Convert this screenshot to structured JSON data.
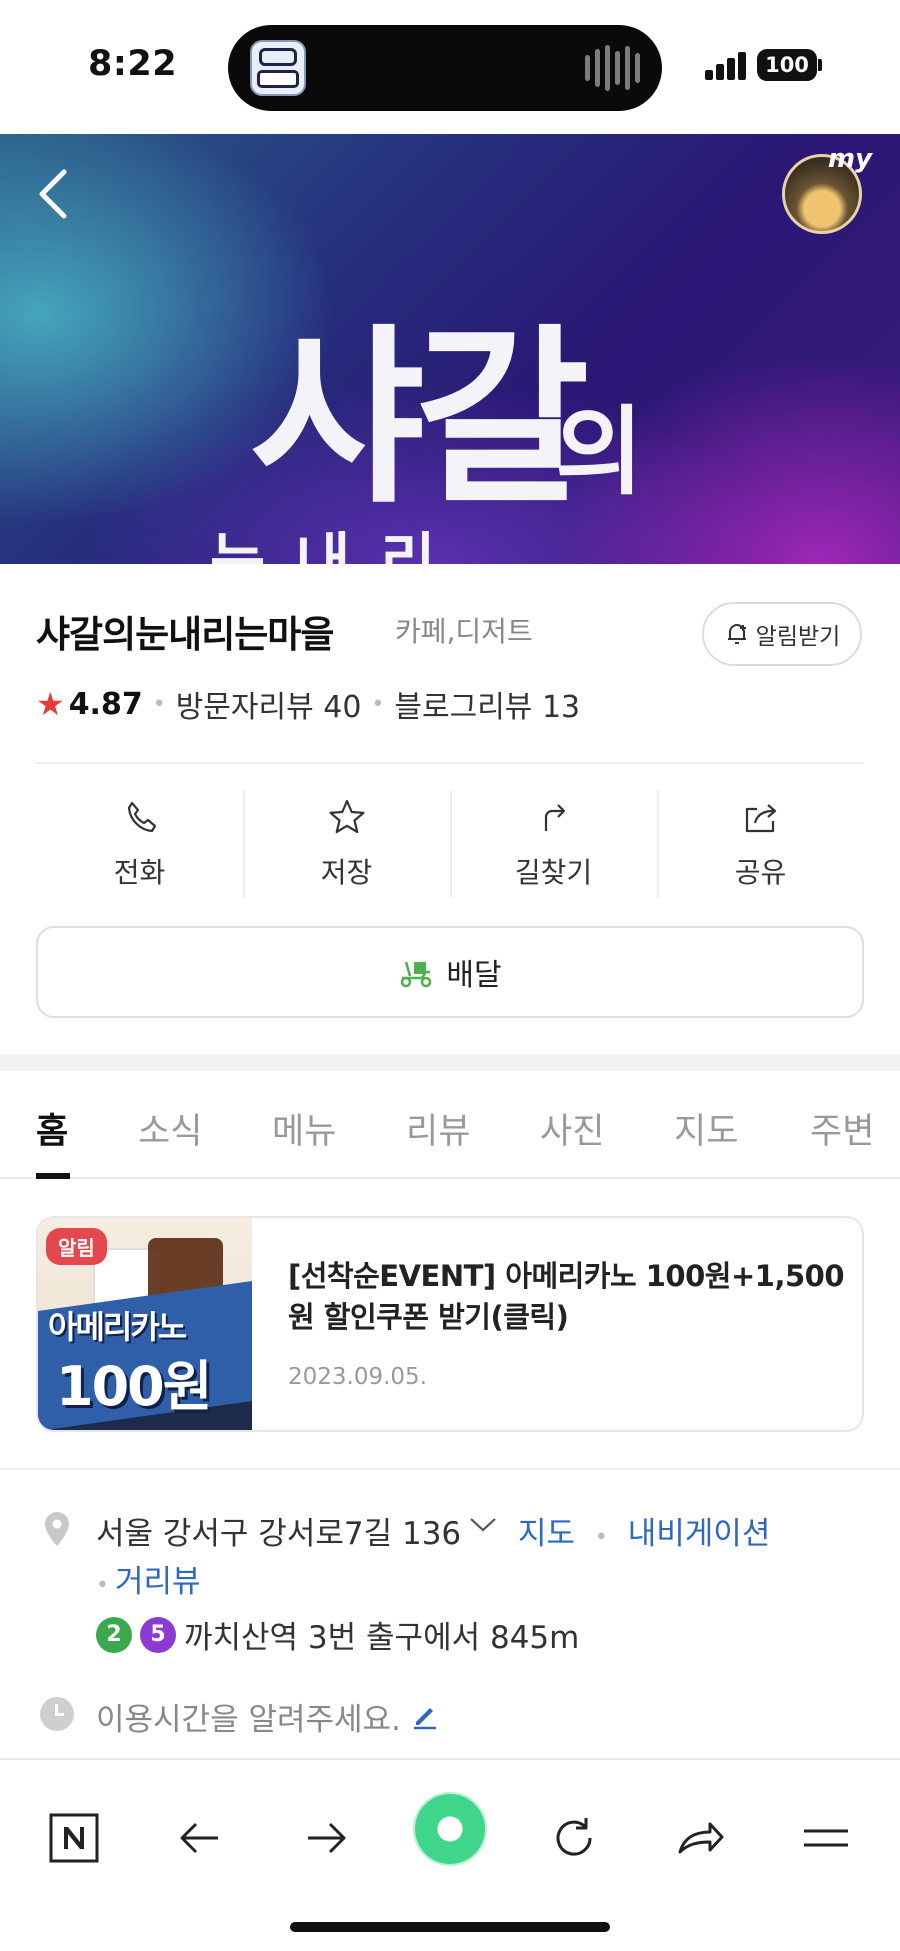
{
  "status_bar": {
    "time": "8:22",
    "battery": "100",
    "island_app_icon": "app-icon"
  },
  "hero": {
    "title": "샤갈",
    "title_suffix": "의",
    "title_bottom": "눈내리",
    "back_icon": "back-chevron-icon",
    "avatar_label": "my"
  },
  "place": {
    "name": "샤갈의눈내리는마을",
    "category": "카페,디저트",
    "alarm_label": "알림받기",
    "rating": "4.87",
    "visitor_reviews": "방문자리뷰 40",
    "blog_reviews": "블로그리뷰 13"
  },
  "actions": [
    {
      "label": "전화",
      "icon": "phone-icon"
    },
    {
      "label": "저장",
      "icon": "star-outline-icon"
    },
    {
      "label": "길찾기",
      "icon": "directions-icon"
    },
    {
      "label": "공유",
      "icon": "share-icon"
    }
  ],
  "delivery": {
    "label": "배달",
    "icon": "delivery-scooter-icon"
  },
  "tabs": [
    "홈",
    "소식",
    "메뉴",
    "리뷰",
    "사진",
    "지도",
    "주변"
  ],
  "active_tab": "홈",
  "event": {
    "badge": "알림",
    "thumb_line1": "아메리카노",
    "thumb_line2": "100원",
    "title": "[선착순EVENT] 아메리카노 100원+1,500원 할인쿠폰 받기(클릭)",
    "date": "2023.09.05."
  },
  "info": {
    "address": "서울 강서구 강서로7길 136",
    "map_link": "지도",
    "navigation_link": "내비게이션",
    "street_view_link": "거리뷰",
    "subway_lines": [
      "2",
      "5"
    ],
    "subway_text": "까치산역 3번 출구에서 845m",
    "hours_prompt": "이용시간을 알려주세요."
  },
  "colors": {
    "accent_link": "#2e68c4",
    "star": "#e9393b",
    "line2": "#3aa84c",
    "line5": "#8b3bd1",
    "green_button": "#3fd58a"
  },
  "browser_bar": [
    "naver-n-icon",
    "back-arrow-icon",
    "forward-arrow-icon",
    "green-dot-icon",
    "reload-icon",
    "share-arrow-icon",
    "menu-icon"
  ]
}
